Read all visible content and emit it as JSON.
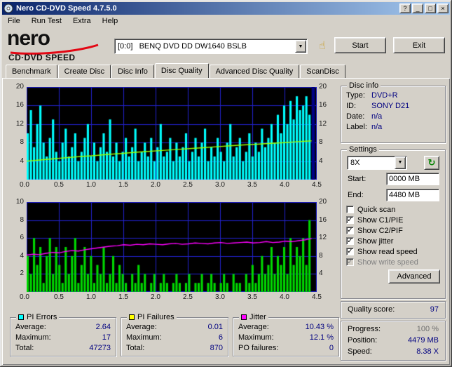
{
  "window": {
    "title": "Nero CD-DVD Speed 4.7.5.0"
  },
  "icons": {
    "help": "?",
    "minimize": "_",
    "maximize": "□",
    "close": "×",
    "dropdown": "▼",
    "refresh": "↻",
    "hand": "☝",
    "check": "✓"
  },
  "menu": [
    "File",
    "Run Test",
    "Extra",
    "Help"
  ],
  "logo": {
    "brand": "nero",
    "product": "CD·DVD SPEED"
  },
  "toolbar": {
    "drive": "[0:0]   BENQ DVD DD DW1640 BSLB",
    "start": "Start",
    "exit": "Exit"
  },
  "tabs": [
    "Benchmark",
    "Create Disc",
    "Disc Info",
    "Disc Quality",
    "Advanced Disc Quality",
    "ScanDisc"
  ],
  "active_tab": "Disc Quality",
  "disc_info": {
    "legend": "Disc info",
    "rows": [
      {
        "label": "Type:",
        "value": "DVD+R"
      },
      {
        "label": "ID:",
        "value": "SONY D21"
      },
      {
        "label": "Date:",
        "value": "n/a"
      },
      {
        "label": "Label:",
        "value": "n/a"
      }
    ]
  },
  "settings": {
    "legend": "Settings",
    "speed_value": "8X",
    "start_label": "Start:",
    "start_value": "0000 MB",
    "end_label": "End:",
    "end_value": "4480 MB",
    "checkboxes": [
      {
        "label": "Quick scan",
        "checked": false,
        "disabled": false
      },
      {
        "label": "Show C1/PIE",
        "checked": true,
        "disabled": false
      },
      {
        "label": "Show C2/PIF",
        "checked": true,
        "disabled": false
      },
      {
        "label": "Show jitter",
        "checked": true,
        "disabled": false
      },
      {
        "label": "Show read speed",
        "checked": true,
        "disabled": false
      },
      {
        "label": "Show write speed",
        "checked": true,
        "disabled": true
      }
    ],
    "advanced": "Advanced"
  },
  "quality": {
    "label": "Quality score:",
    "value": "97"
  },
  "progress": {
    "rows": [
      {
        "label": "Progress:",
        "value": "100 %"
      },
      {
        "label": "Position:",
        "value": "4479 MB"
      },
      {
        "label": "Speed:",
        "value": "8.38 X"
      }
    ]
  },
  "stats": [
    {
      "legend": "PI Errors",
      "chip": "#00ffff",
      "rows": [
        [
          "Average:",
          "2.64"
        ],
        [
          "Maximum:",
          "17"
        ],
        [
          "Total:",
          "47273"
        ]
      ]
    },
    {
      "legend": "PI Failures",
      "chip": "#ffff00",
      "rows": [
        [
          "Average:",
          "0.01"
        ],
        [
          "Maximum:",
          "6"
        ],
        [
          "Total:",
          "870"
        ]
      ]
    },
    {
      "legend": "Jitter",
      "chip": "#ff00ff",
      "rows": [
        [
          "Average:",
          "10.43 %"
        ],
        [
          "Maximum:",
          "12.1 %"
        ],
        [
          "PO failures:",
          "0"
        ]
      ]
    }
  ],
  "colors": {
    "chart_bg": "#000000",
    "grid": "#2222cc",
    "pie": "#00ffff",
    "speed": "#9cff00",
    "pif": "#00d800",
    "jitter": "#ff00ff",
    "end_block": "#000086",
    "value_text": "#000080"
  },
  "chart_data": [
    {
      "name": "pi-errors-chart",
      "type": "area+line",
      "x_min": 0,
      "x_max": 4.5,
      "data_end_x": 4.42,
      "x_ticks": [
        "0.0",
        "0.5",
        "1.0",
        "1.5",
        "2.0",
        "2.5",
        "3.0",
        "3.5",
        "4.0",
        "4.5"
      ],
      "left_axis": {
        "max": 20,
        "ticks": [
          20,
          16,
          12,
          8,
          4
        ]
      },
      "right_axis": {
        "max": 20,
        "ticks": [
          20,
          16,
          12,
          8,
          4
        ]
      },
      "bars": {
        "series": "PI Errors",
        "color": "#00ffff",
        "axis": "left",
        "values": [
          10,
          15,
          7,
          12,
          16,
          8,
          5,
          9,
          13,
          6,
          4,
          8,
          11,
          5,
          7,
          10,
          4,
          6,
          9,
          12,
          5,
          8,
          4,
          7,
          10,
          6,
          13,
          5,
          8,
          4,
          6,
          9,
          5,
          7,
          11,
          4,
          6,
          8,
          5,
          9,
          4,
          7,
          12,
          5,
          6,
          9,
          4,
          8,
          5,
          7,
          10,
          4,
          6,
          9,
          5,
          8,
          11,
          4,
          7,
          5,
          9,
          6,
          4,
          8,
          12,
          5,
          7,
          9,
          4,
          6,
          10,
          5,
          8,
          6,
          11,
          7,
          9,
          12,
          8,
          14,
          10,
          16,
          12,
          17,
          13,
          18,
          15,
          16,
          18,
          14
        ]
      },
      "line": {
        "series": "Read speed",
        "color": "#9cff00",
        "axis": "right",
        "values": [
          4.0,
          4.25,
          4.5,
          4.75,
          5.0,
          5.2,
          5.45,
          5.65,
          5.9,
          6.1,
          6.3,
          6.5,
          6.7,
          6.9,
          7.1,
          7.3,
          7.5,
          7.65,
          7.85,
          8.0,
          8.2,
          8.38
        ]
      },
      "end_block": {
        "x0": 4.42,
        "x1": 4.47,
        "color": "#000086"
      }
    },
    {
      "name": "pi-failures-chart",
      "type": "bar+line",
      "x_min": 0,
      "x_max": 4.5,
      "data_end_x": 4.42,
      "x_ticks": [
        "0.0",
        "0.5",
        "1.0",
        "1.5",
        "2.0",
        "2.5",
        "3.0",
        "3.5",
        "4.0",
        "4.5"
      ],
      "left_axis": {
        "max": 10,
        "ticks": [
          10,
          8,
          6,
          4,
          2
        ]
      },
      "right_axis": {
        "max": 20,
        "ticks": [
          20,
          16,
          12,
          8,
          4
        ]
      },
      "bars": {
        "series": "PI Failures",
        "color": "#00d800",
        "axis": "left",
        "values": [
          4,
          2,
          6,
          3,
          5,
          1,
          4,
          6,
          2,
          5,
          3,
          1,
          5,
          2,
          4,
          6,
          1,
          3,
          5,
          2,
          4,
          1,
          3,
          2,
          5,
          1,
          2,
          4,
          1,
          3,
          2,
          1,
          0,
          2,
          1,
          3,
          1,
          2,
          0,
          1,
          2,
          0,
          1,
          2,
          1,
          0,
          1,
          2,
          1,
          0,
          1,
          2,
          0,
          1,
          1,
          2,
          0,
          1,
          2,
          1,
          0,
          1,
          2,
          1,
          0,
          2,
          1,
          1,
          0,
          2,
          1,
          3,
          1,
          2,
          4,
          2,
          3,
          5,
          2,
          4,
          3,
          5,
          2,
          6,
          3,
          5,
          4,
          6,
          3,
          8
        ]
      },
      "line": {
        "series": "Jitter",
        "color": "#ff00ff",
        "axis": "right",
        "values": [
          8.2,
          8.4,
          8.3,
          8.6,
          8.8,
          8.7,
          9.0,
          9.2,
          9.1,
          9.4,
          9.6,
          9.8,
          10.0,
          10.2,
          10.3,
          10.5,
          10.4,
          10.6,
          10.5,
          10.7,
          10.6,
          10.5,
          10.7,
          10.8,
          10.6,
          10.7,
          10.9,
          10.8,
          10.7,
          10.9,
          11.0,
          10.8,
          10.9,
          11.0,
          11.1,
          10.9,
          11.0,
          11.2,
          11.0,
          11.1,
          11.3,
          11.2,
          11.4,
          11.6,
          11.9
        ]
      }
    }
  ]
}
